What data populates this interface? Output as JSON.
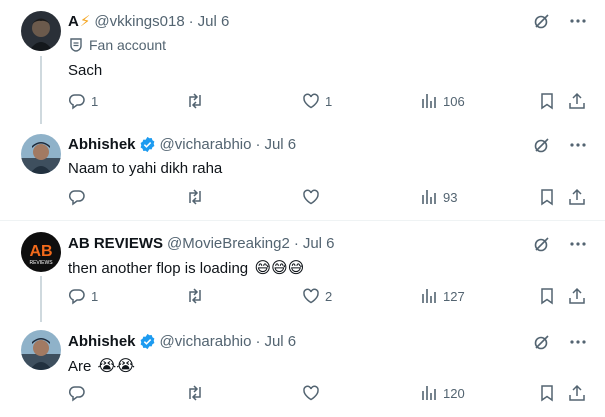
{
  "tweets": [
    {
      "name": "A",
      "name_suffix": "⚡",
      "handle": "@vkkings018",
      "date": "Jul 6",
      "fan_label": "Fan account",
      "text": "Sach",
      "replies": "1",
      "retweets": "",
      "likes": "1",
      "views": "106"
    },
    {
      "name": "Abhishek",
      "handle": "@vicharabhio",
      "date": "Jul 6",
      "text": "Naam to yahi dikh raha",
      "replies": "",
      "retweets": "",
      "likes": "",
      "views": "93"
    },
    {
      "name": "AB REVIEWS",
      "handle": "@MovieBreaking2",
      "date": "Jul 6",
      "text": "then another flop is loading",
      "emojis": "😅😅😅",
      "replies": "1",
      "retweets": "",
      "likes": "2",
      "views": "127"
    },
    {
      "name": "Abhishek",
      "handle": "@vicharabhio",
      "date": "Jul 6",
      "text": "Are",
      "emojis": "😭😭",
      "replies": "",
      "retweets": "",
      "likes": "",
      "views": "120"
    }
  ],
  "avatar_texts": {
    "ab_logo": "AB",
    "ab_sub": "REVIEWS"
  },
  "colors": {
    "icon": "#536471",
    "verified": "#1d9bf0",
    "line": "#cfd9de",
    "divider": "#eff3f4"
  },
  "icons": [
    "reply-icon",
    "retweet-icon",
    "like-icon",
    "views-icon",
    "bookmark-icon",
    "share-icon",
    "grok-icon",
    "more-icon",
    "verified-icon",
    "fan-account-icon"
  ]
}
